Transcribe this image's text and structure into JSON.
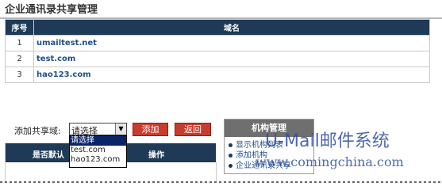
{
  "page": {
    "title": "企业通讯录共享管理"
  },
  "table": {
    "headers": [
      "序号",
      "域名"
    ],
    "rows": [
      {
        "num": "1",
        "domain": "umailtest.net"
      },
      {
        "num": "2",
        "domain": "test.com"
      },
      {
        "num": "3",
        "domain": "hao123.com"
      }
    ]
  },
  "add_form": {
    "label": "添加共享域:",
    "select_value": "请选择",
    "options": [
      "请选择",
      "test.com",
      "hao123.com"
    ],
    "add_button": "添加",
    "back_button": "返回"
  },
  "member_table": {
    "col_shared": "是否默认",
    "col_action": "操作"
  },
  "org_panel": {
    "title": "机构管理",
    "links": [
      "显示机构列表",
      "添加机构",
      "企业通讯录共享"
    ]
  },
  "watermark": {
    "logo": "U-Mail邮件系统",
    "url": "www.comingchina.com"
  },
  "colors": {
    "header_bg": "#1e3a57",
    "button_bg": "#c83c2e",
    "link": "#1f4f8a",
    "panel_header": "#6f6f6f"
  }
}
